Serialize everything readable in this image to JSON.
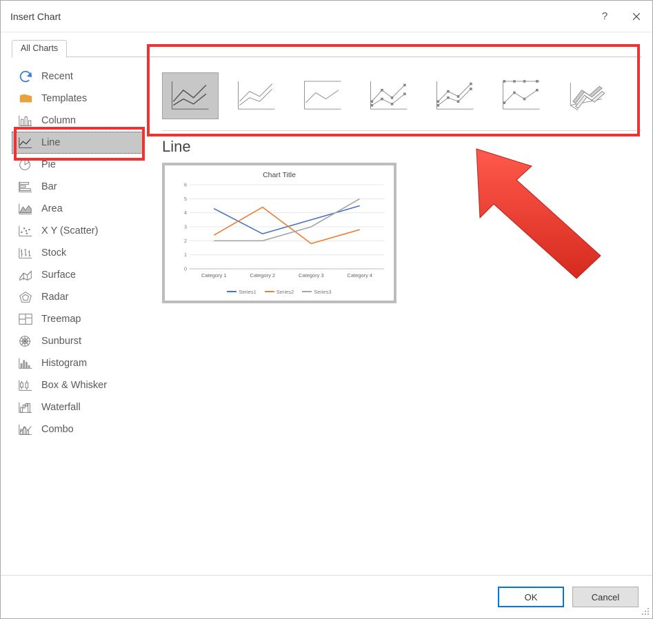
{
  "window": {
    "title": "Insert Chart"
  },
  "tab_label": "All Charts",
  "sidebar": {
    "items": [
      {
        "label": "Recent"
      },
      {
        "label": "Templates"
      },
      {
        "label": "Column"
      },
      {
        "label": "Line"
      },
      {
        "label": "Pie"
      },
      {
        "label": "Bar"
      },
      {
        "label": "Area"
      },
      {
        "label": "X Y (Scatter)"
      },
      {
        "label": "Stock"
      },
      {
        "label": "Surface"
      },
      {
        "label": "Radar"
      },
      {
        "label": "Treemap"
      },
      {
        "label": "Sunburst"
      },
      {
        "label": "Histogram"
      },
      {
        "label": "Box & Whisker"
      },
      {
        "label": "Waterfall"
      },
      {
        "label": "Combo"
      }
    ],
    "selected_index": 3
  },
  "subtype_title": "Line",
  "buttons": {
    "ok": "OK",
    "cancel": "Cancel"
  },
  "preview": {
    "title": "Chart Title",
    "legend": [
      "Series1",
      "Series2",
      "Series3"
    ]
  },
  "chart_data": {
    "type": "line",
    "title": "Chart Title",
    "xlabel": "",
    "ylabel": "",
    "ylim": [
      0,
      6
    ],
    "yticks": [
      0,
      1,
      2,
      3,
      4,
      5,
      6
    ],
    "categories": [
      "Category 1",
      "Category 2",
      "Category 3",
      "Category 4"
    ],
    "series": [
      {
        "name": "Series1",
        "color": "#4472c4",
        "values": [
          4.3,
          2.5,
          3.5,
          4.5
        ]
      },
      {
        "name": "Series2",
        "color": "#ed7d31",
        "values": [
          2.4,
          4.4,
          1.8,
          2.8
        ]
      },
      {
        "name": "Series3",
        "color": "#a5a5a5",
        "values": [
          2.0,
          2.0,
          3.0,
          5.0
        ]
      }
    ]
  }
}
